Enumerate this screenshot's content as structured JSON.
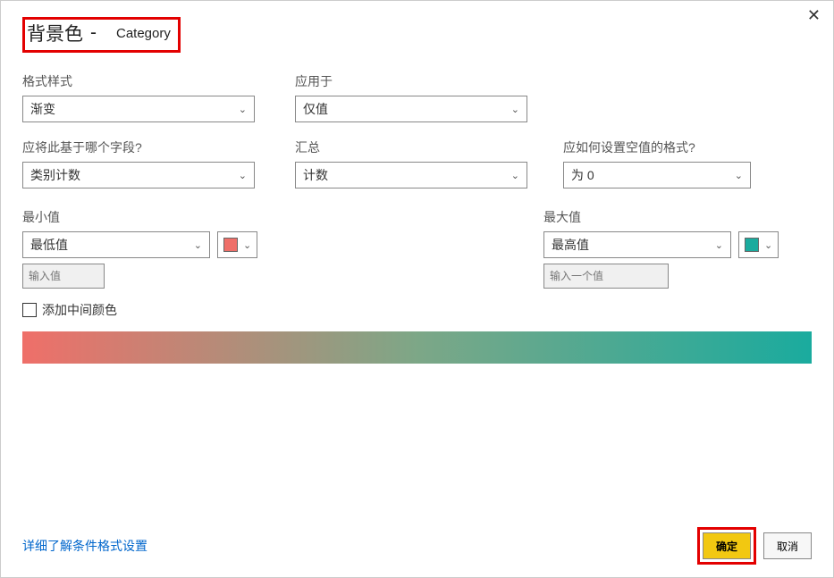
{
  "title": {
    "main": "背景色",
    "dash": "-",
    "category": "Category"
  },
  "row1": {
    "format_style": {
      "label": "格式样式",
      "value": "渐变"
    },
    "apply_to": {
      "label": "应用于",
      "value": "仅值"
    }
  },
  "row2": {
    "base_field": {
      "label": "应将此基于哪个字段?",
      "value": "类别计数"
    },
    "summarize": {
      "label": "汇总",
      "value": "计数"
    },
    "empty_format": {
      "label": "应如何设置空值的格式?",
      "value": "为 0"
    }
  },
  "min": {
    "label": "最小值",
    "select_value": "最低值",
    "placeholder": "输入值",
    "color": "#ef6f69"
  },
  "max": {
    "label": "最大值",
    "select_value": "最高值",
    "placeholder": "输入一个值",
    "color": "#1aab9e"
  },
  "midpoint": {
    "label": "添加中间颜色"
  },
  "footer": {
    "link": "详细了解条件格式设置",
    "ok": "确定",
    "cancel": "取消"
  }
}
